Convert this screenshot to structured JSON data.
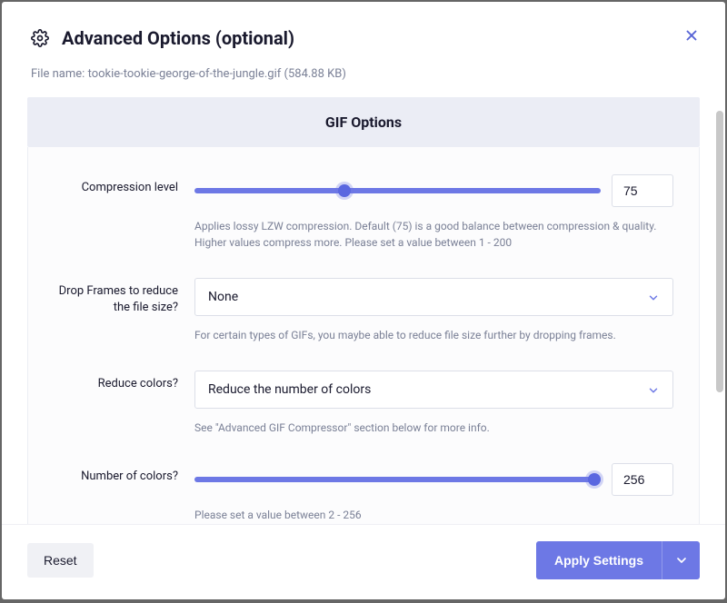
{
  "header": {
    "title": "Advanced Options (optional)"
  },
  "file": {
    "label": "File name:",
    "name": "tookie-tookie-george-of-the-jungle.gif",
    "size": "(584.88 KB)"
  },
  "banner": "GIF Options",
  "compression": {
    "label": "Compression level",
    "value": "75",
    "help": "Applies lossy LZW compression. Default (75) is a good balance between compression & quality. Higher values compress more. Please set a value between 1 - 200"
  },
  "dropframes": {
    "label": "Drop Frames to reduce the file size?",
    "value": "None",
    "help": "For certain types of GIFs, you maybe able to reduce file size further by dropping frames."
  },
  "reducecolors": {
    "label": "Reduce colors?",
    "value": "Reduce the number of colors",
    "help": "See \"Advanced GIF Compressor\" section below for more info."
  },
  "numcolors": {
    "label": "Number of colors?",
    "value": "256",
    "help": "Please set a value between 2 - 256"
  },
  "footer": {
    "reset": "Reset",
    "apply": "Apply Settings"
  }
}
